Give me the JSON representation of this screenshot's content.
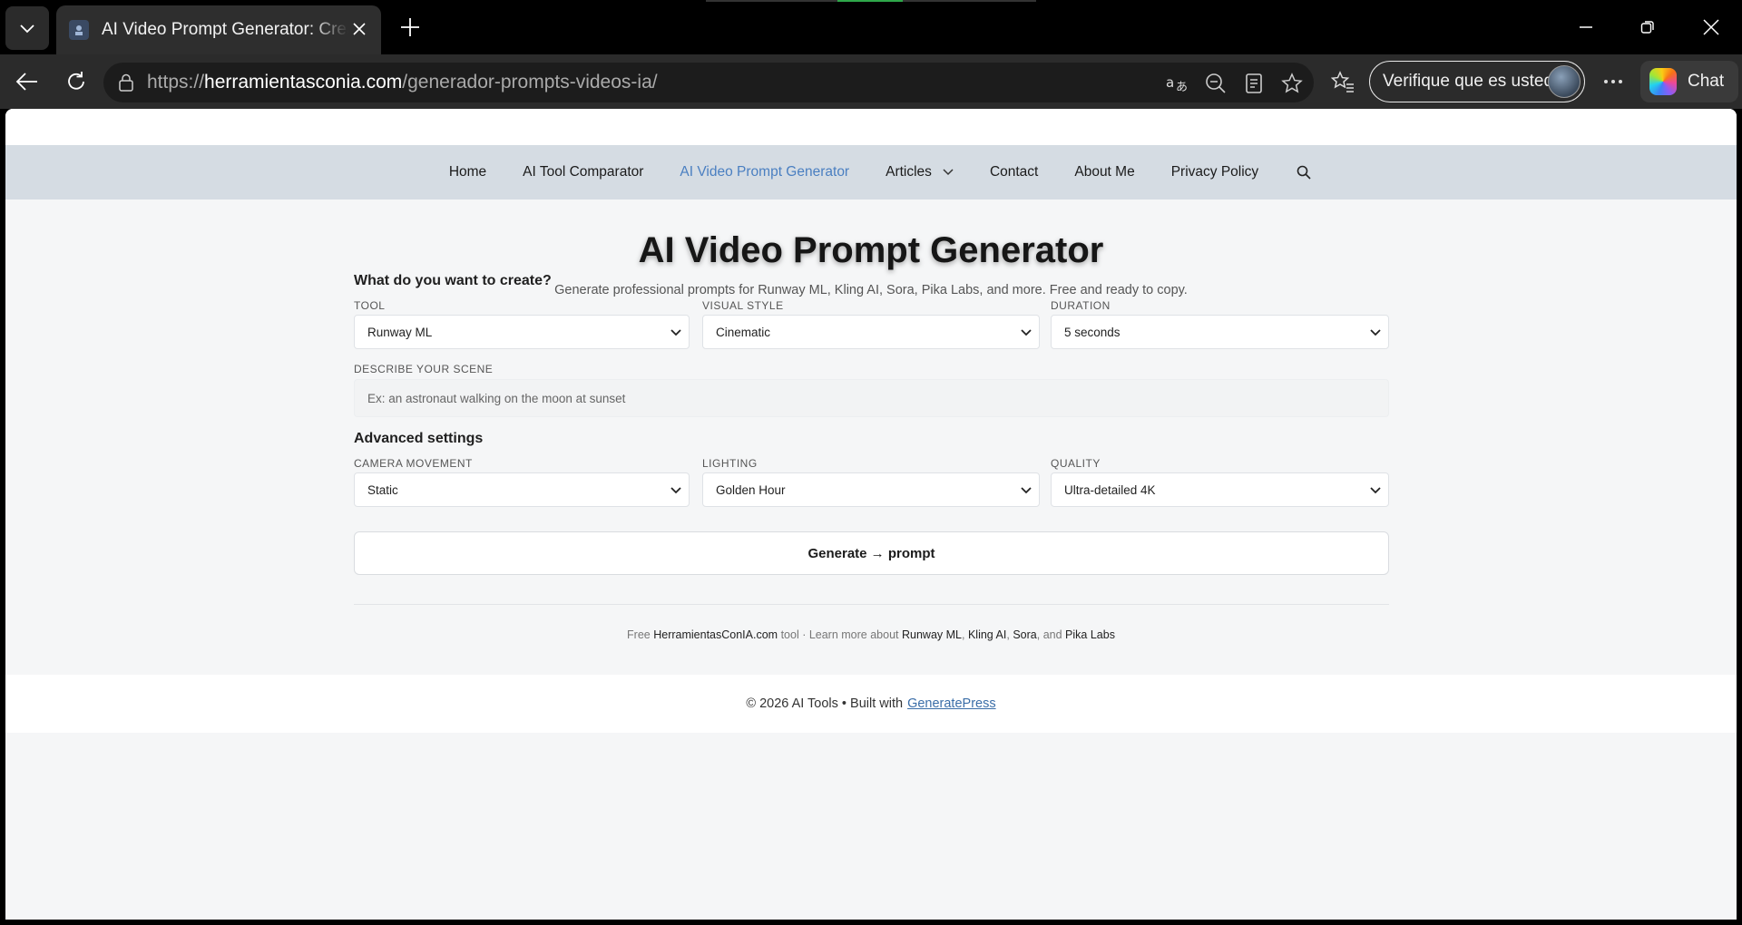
{
  "browser": {
    "tab_title": "AI Video Prompt Generator: Create",
    "url_scheme": "https://",
    "url_host": "herramientasconia.com",
    "url_path": "/generador-prompts-videos-ia/",
    "profile_label": "Verifique que es usted",
    "chat_label": "Chat"
  },
  "nav": {
    "items": [
      "Home",
      "AI Tool Comparator",
      "AI Video Prompt Generator",
      "Articles",
      "Contact",
      "About Me",
      "Privacy Policy"
    ],
    "active": "AI Video Prompt Generator"
  },
  "page": {
    "title": "AI Video Prompt Generator",
    "subtitle": "Generate professional prompts for Runway ML, Kling AI, Sora, Pika Labs, and more. Free and ready to copy."
  },
  "form": {
    "section1": "What do you want to create?",
    "tool_label": "TOOL",
    "tool_value": "Runway ML",
    "style_label": "VISUAL STYLE",
    "style_value": "Cinematic",
    "duration_label": "DURATION",
    "duration_value": "5 seconds",
    "scene_label": "DESCRIBE YOUR SCENE",
    "scene_placeholder": "Ex: an astronaut walking on the moon at sunset",
    "section2": "Advanced settings",
    "camera_label": "CAMERA MOVEMENT",
    "camera_value": "Static",
    "lighting_label": "LIGHTING",
    "lighting_value": "Golden Hour",
    "quality_label": "QUALITY",
    "quality_value": "Ultra-detailed 4K",
    "generate_label": "Generate → prompt"
  },
  "note": {
    "prefix": "Free",
    "site": "HerramientasConIA.com",
    "middle": "tool · Learn more about",
    "links": [
      "Runway ML",
      "Kling AI",
      "Sora"
    ],
    "and": "and",
    "last": "Pika Labs"
  },
  "footer": {
    "text": "© 2026 AI Tools • Built with",
    "link": "GeneratePress"
  },
  "colors": {
    "nav_bg": "#d5dce3",
    "active_link": "#4a7fc1",
    "page_bg": "#f5f6f7"
  }
}
